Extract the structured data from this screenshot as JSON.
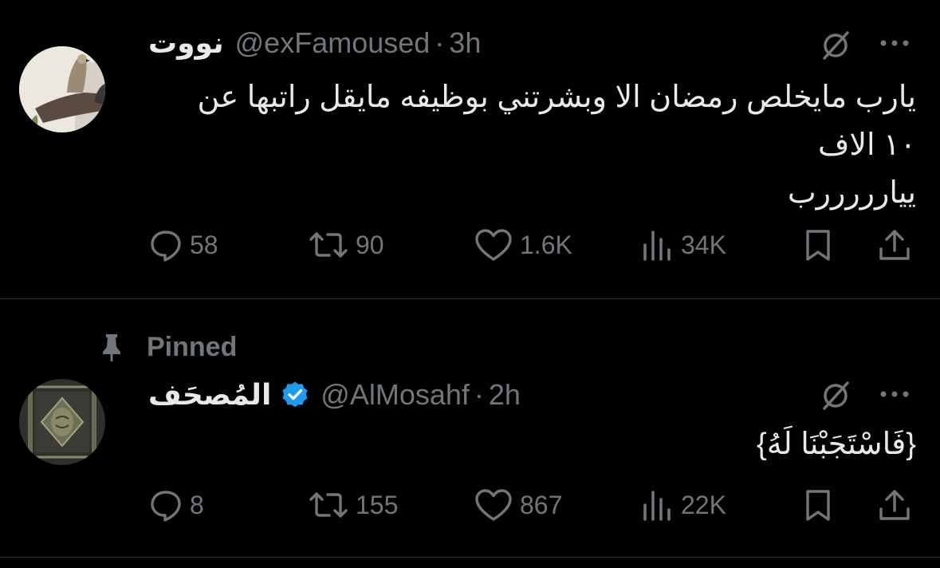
{
  "tweets": [
    {
      "display_name": "نووت",
      "handle": "@exFamoused",
      "separator": "·",
      "time": "3h",
      "text_lines": [
        "يارب مايخلص رمضان الا وبشرتني بوظيفه مايقل راتبها عن",
        "١٠ الاف",
        "ييارررررب"
      ],
      "stats": {
        "replies": "58",
        "reposts": "90",
        "likes": "1.6K",
        "views": "34K"
      }
    },
    {
      "pinned_label": "Pinned",
      "display_name": "المُصحَف",
      "verified": true,
      "handle": "@AlMosahf",
      "separator": "·",
      "time": "2h",
      "text_lines": [
        "{فَاسْتَجَبْنَا لَهُ}"
      ],
      "stats": {
        "replies": "8",
        "reposts": "155",
        "likes": "867",
        "views": "22K"
      }
    }
  ],
  "icons": {
    "reply": "reply-icon",
    "repost": "repost-icon",
    "like": "heart-icon",
    "views": "views-icon",
    "bookmark": "bookmark-icon",
    "share": "share-icon",
    "grok": "grok-icon",
    "more": "more-icon",
    "pin": "pin-icon",
    "verified": "verified-badge-icon"
  },
  "colors": {
    "background": "#000000",
    "text": "#e7e9ea",
    "secondary": "#71767b",
    "divider": "#2f3336",
    "verified": "#1d9bf0"
  }
}
